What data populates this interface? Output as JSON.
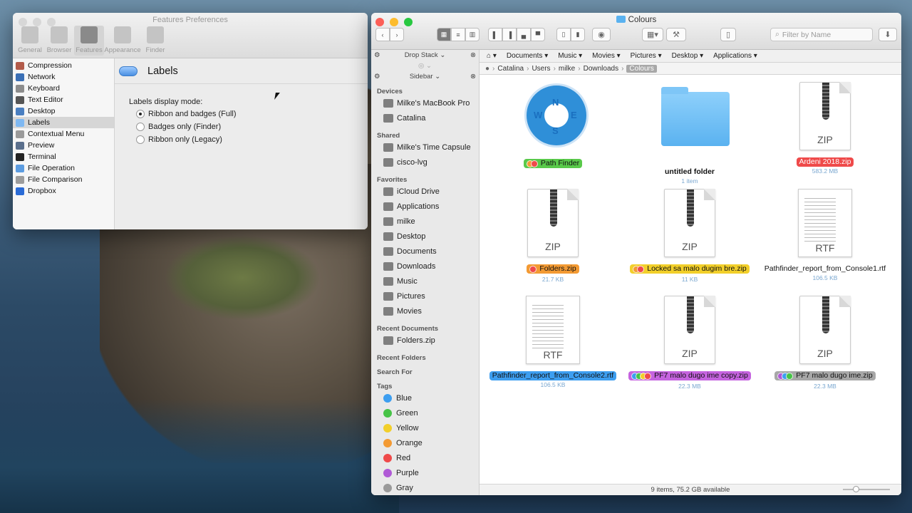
{
  "prefs": {
    "title": "Features Preferences",
    "toolbar": [
      "General",
      "Browser",
      "Features",
      "Appearance",
      "Finder"
    ],
    "sidebar": [
      {
        "label": "Compression",
        "color": "#b25b4a"
      },
      {
        "label": "Network",
        "color": "#3a6fb5"
      },
      {
        "label": "Keyboard",
        "color": "#8c8c8c"
      },
      {
        "label": "Text Editor",
        "color": "#555"
      },
      {
        "label": "Desktop",
        "color": "#4a7fc1"
      },
      {
        "label": "Labels",
        "color": "#7eb8f2"
      },
      {
        "label": "Contextual Menu",
        "color": "#9a9a9a"
      },
      {
        "label": "Preview",
        "color": "#5a6f8c"
      },
      {
        "label": "Terminal",
        "color": "#222"
      },
      {
        "label": "File Operation",
        "color": "#5c9ce0"
      },
      {
        "label": "File Comparison",
        "color": "#9c9c9c"
      },
      {
        "label": "Dropbox",
        "color": "#2a6bd6"
      }
    ],
    "selected_sidebar": "Labels",
    "heading": "Labels",
    "display_mode_label": "Labels display mode:",
    "options": [
      "Ribbon and badges (Full)",
      "Badges only (Finder)",
      "Ribbon only (Legacy)"
    ],
    "selected_option": "Ribbon and badges (Full)"
  },
  "pathfinder": {
    "title": "Colours",
    "filter_placeholder": "Filter by Name",
    "drop_stack_label": "Drop Stack",
    "sidebar_label": "Sidebar",
    "sections": {
      "devices": {
        "label": "Devices",
        "items": [
          "Milke's MacBook Pro",
          "Catalina"
        ]
      },
      "shared": {
        "label": "Shared",
        "items": [
          "Milke's Time Capsule",
          "cisco-lvg"
        ]
      },
      "favorites": {
        "label": "Favorites",
        "items": [
          "iCloud Drive",
          "Applications",
          "milke",
          "Desktop",
          "Documents",
          "Downloads",
          "Music",
          "Pictures",
          "Movies"
        ]
      },
      "recent_documents": {
        "label": "Recent Documents",
        "items": [
          "Folders.zip"
        ]
      },
      "recent_folders": {
        "label": "Recent Folders"
      },
      "search_for": {
        "label": "Search For"
      },
      "tags": {
        "label": "Tags",
        "items": [
          {
            "name": "Blue",
            "color": "#3d9ef0"
          },
          {
            "name": "Green",
            "color": "#46c346"
          },
          {
            "name": "Yellow",
            "color": "#f2cf2a"
          },
          {
            "name": "Orange",
            "color": "#f39a33"
          },
          {
            "name": "Red",
            "color": "#ef4a4a"
          },
          {
            "name": "Purple",
            "color": "#b05ad6"
          },
          {
            "name": "Gray",
            "color": "#9a9a9a"
          }
        ]
      }
    },
    "locations": [
      "Documents",
      "Music",
      "Movies",
      "Pictures",
      "Desktop",
      "Applications"
    ],
    "breadcrumb": [
      "Catalina",
      "Users",
      "milke",
      "Downloads",
      "Colours"
    ],
    "files": [
      {
        "name": "Path Finder",
        "sub": "",
        "type": "app",
        "bg": "#59c94a",
        "fg": "#111",
        "dots": [
          "#f39a33",
          "#ef4a4a"
        ]
      },
      {
        "name": "untitled folder",
        "sub": "1 item",
        "type": "folder",
        "bg": "transparent",
        "fg": "#111",
        "dots": []
      },
      {
        "name": "Ardeni 2018.zip",
        "sub": "583.2 MB",
        "type": "zip",
        "bg": "#ef4a4a",
        "fg": "#fff",
        "dots": []
      },
      {
        "name": "Folders.zip",
        "sub": "21.7 KB",
        "type": "zip",
        "bg": "#f39a33",
        "fg": "#111",
        "dots": [
          "#ef4a4a"
        ]
      },
      {
        "name": "Locked sa malo dugim bre.zip",
        "sub": "11 KB",
        "type": "zip",
        "bg": "#f2cf2a",
        "fg": "#111",
        "dots": [
          "#f39a33",
          "#ef4a4a"
        ]
      },
      {
        "name": "Pathfinder_report_from_Console1.rtf",
        "sub": "106.5 KB",
        "type": "rtf",
        "bg": "transparent",
        "fg": "#111",
        "dots": []
      },
      {
        "name": "Pathfinder_report_from_Console2.rtf",
        "sub": "106.5 KB",
        "type": "rtf",
        "bg": "#3d9ef0",
        "fg": "#111",
        "dots": []
      },
      {
        "name": "PF7 malo dugo ime copy.zip",
        "sub": "22.3 MB",
        "type": "zip",
        "bg": "#c563df",
        "fg": "#111",
        "dots": [
          "#3d9ef0",
          "#46c346",
          "#f2cf2a",
          "#ef4a4a"
        ]
      },
      {
        "name": "PF7 malo dugo ime.zip",
        "sub": "22.3 MB",
        "type": "zip",
        "bg": "#a7a7a7",
        "fg": "#111",
        "dots": [
          "#b05ad6",
          "#3d9ef0",
          "#46c346"
        ]
      }
    ],
    "status": "9 items, 75.2 GB available"
  },
  "icons": {
    "zip_label": "ZIP",
    "rtf_label": "RTF",
    "app_letters": [
      "W",
      "N",
      "E",
      "S"
    ]
  }
}
